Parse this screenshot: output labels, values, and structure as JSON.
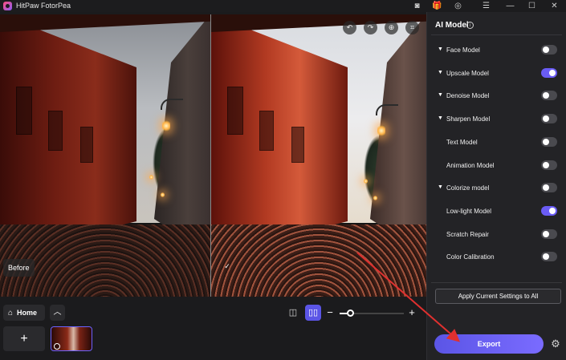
{
  "app": {
    "title": "HitPaw FotorPea"
  },
  "titlebar": {
    "icons": [
      "discord-icon",
      "gift-icon",
      "user-icon",
      "menu-icon",
      "minimize-icon",
      "maximize-icon",
      "close-icon"
    ]
  },
  "preview": {
    "before_label": "Before",
    "after_icon": "checkmark-icon",
    "tools": [
      "undo-icon",
      "redo-icon",
      "zoom-icon",
      "crop-icon"
    ]
  },
  "bottom": {
    "home_label": "Home",
    "up_icon": "chevron-up-icon",
    "view_single_icon": "single-view-icon",
    "view_split_icon": "split-view-icon",
    "zoom_level": 0.17,
    "add_label": "+"
  },
  "panel": {
    "title": "AI Model",
    "models": [
      {
        "label": "Face Model",
        "expandable": true,
        "on": false
      },
      {
        "label": "Upscale Model",
        "expandable": true,
        "on": true
      },
      {
        "label": "Denoise Model",
        "expandable": true,
        "on": false
      },
      {
        "label": "Sharpen Model",
        "expandable": true,
        "on": false
      },
      {
        "label": "Text Model",
        "expandable": false,
        "on": false
      },
      {
        "label": "Animation Model",
        "expandable": false,
        "on": false
      },
      {
        "label": "Colorize model",
        "expandable": true,
        "on": false
      },
      {
        "label": "Low-light Model",
        "expandable": false,
        "on": true
      },
      {
        "label": "Scratch Repair",
        "expandable": false,
        "on": false
      },
      {
        "label": "Color Calibration",
        "expandable": false,
        "on": false
      }
    ],
    "apply_label": "Apply Current Settings to All",
    "export_label": "Export"
  },
  "colors": {
    "accent": "#6a5cf5",
    "annotation_arrow": "#e0302f"
  }
}
